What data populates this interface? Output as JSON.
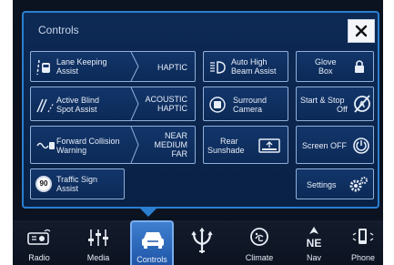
{
  "panel": {
    "title": "Controls"
  },
  "tiles": {
    "lane_keeping": {
      "label_1": "Lane Keeping",
      "label_2": "Assist",
      "value": "HAPTIC"
    },
    "active_blind": {
      "label_1": "Active Blind",
      "label_2": "Spot Assist",
      "value_1": "ACOUSTIC",
      "value_2": "HAPTIC"
    },
    "forward_collision": {
      "label_1": "Forward Collision",
      "label_2": "Warning",
      "value_1": "NEAR",
      "value_2": "MEDIUM",
      "value_3": "FAR"
    },
    "traffic_sign": {
      "label_1": "Traffic Sign",
      "label_2": "Assist",
      "badge": "90"
    },
    "auto_high_beam": {
      "label_1": "Auto High",
      "label_2": "Beam Assist"
    },
    "surround_camera": {
      "label_1": "Surround",
      "label_2": "Camera"
    },
    "rear_sunshade": {
      "label_1": "Rear",
      "label_2": "Sunshade"
    },
    "glove_box": {
      "label_1": "Glove",
      "label_2": "Box"
    },
    "start_stop": {
      "label_1": "Start & Stop",
      "label_2": "Off"
    },
    "screen_off": {
      "label": "Screen OFF"
    },
    "settings": {
      "label": "Settings"
    }
  },
  "tabs": [
    {
      "label": "Radio",
      "icon": "radio-icon"
    },
    {
      "label": "Media",
      "icon": "media-icon"
    },
    {
      "label": "Controls",
      "icon": "car-icon",
      "active": true
    },
    {
      "label": "",
      "icon": "trident-logo-icon"
    },
    {
      "label": "Climate",
      "icon": "climate-icon"
    },
    {
      "label": "Nav",
      "icon": "compass-icon"
    },
    {
      "label": "Phone",
      "icon": "phone-icon"
    }
  ],
  "nav_heading": "NE",
  "colors": {
    "accent": "#2a7fd0",
    "panel": "#0d2a55",
    "tile_border": "#8fb0d8"
  }
}
